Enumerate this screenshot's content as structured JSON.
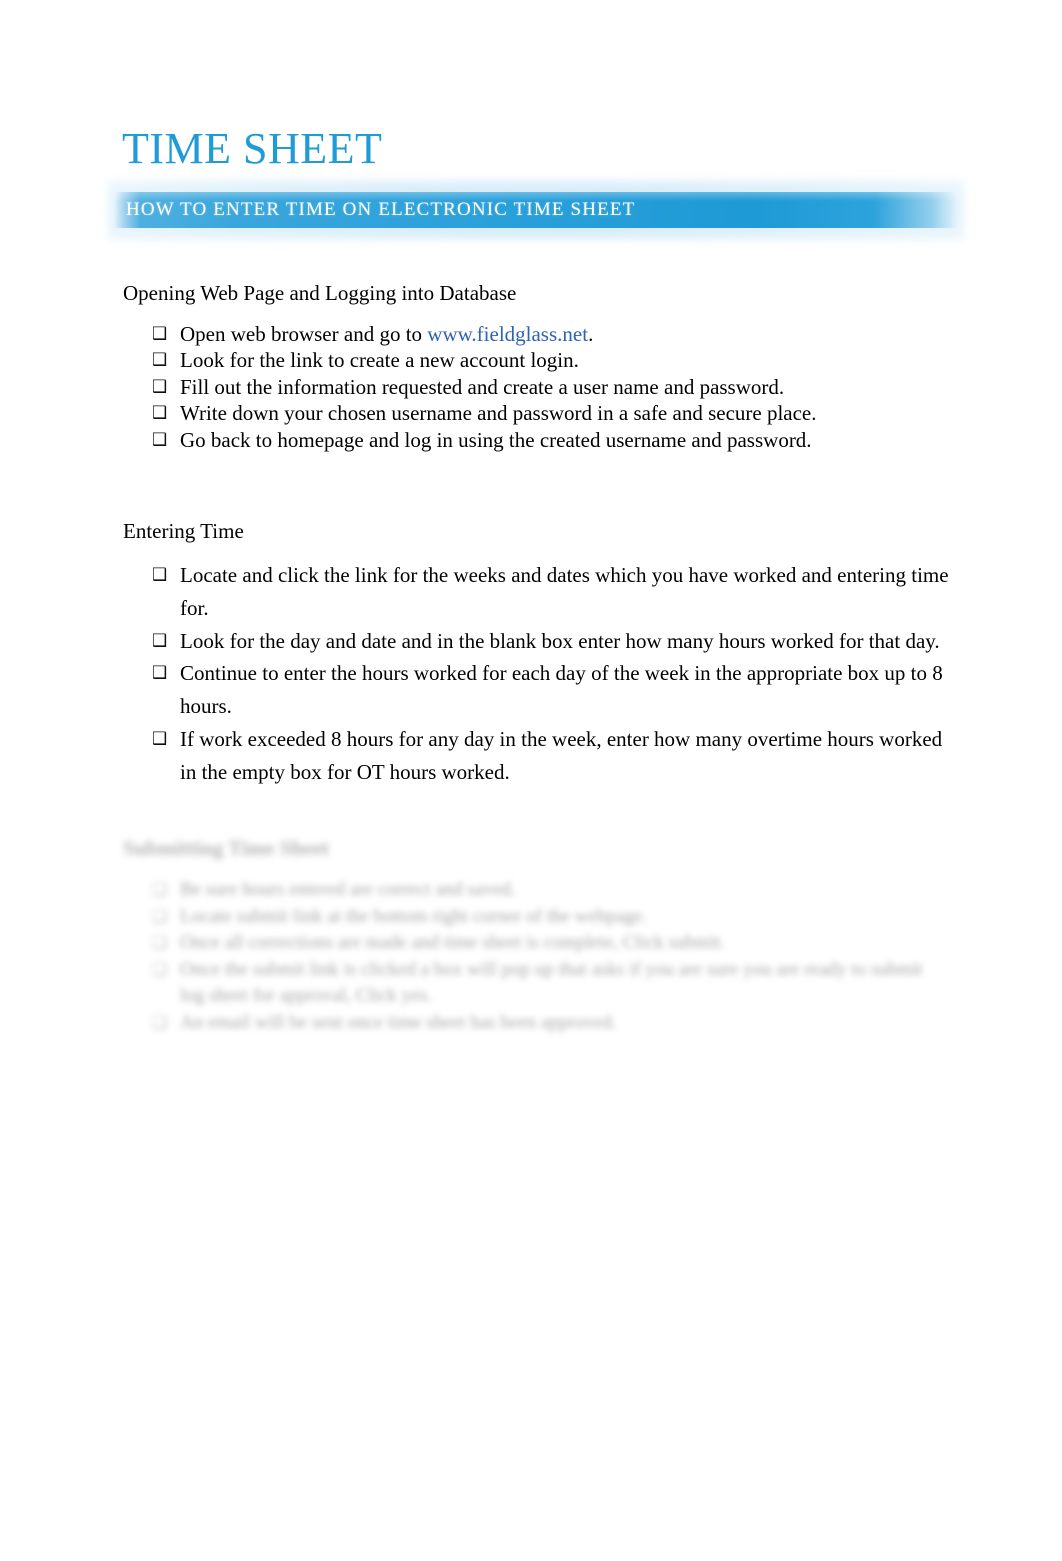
{
  "document": {
    "title": "TIME SHEET",
    "banner_subtitle": "HOW TO ENTER TIME ON ELECTRONIC TIME SHEET",
    "bullet_glyph": "❑",
    "colors": {
      "title_blue": "#1f9bd8",
      "banner_blue_left": "#4fb0e0",
      "banner_blue_right": "#1e9ad6",
      "link_blue": "#2d63b3",
      "body_text": "#000000",
      "page_background": "#ffffff"
    }
  },
  "sections": [
    {
      "heading": "Opening Web Page and Logging into Database",
      "items": [
        {
          "before": "Open web browser and go to ",
          "link": "www.fieldglass.net",
          "after": "."
        },
        {
          "text": "Look for the link to create a new account login."
        },
        {
          "text": "Fill out the information requested and create a user name and password."
        },
        {
          "text": "Write down your chosen username and password in a safe and secure place."
        },
        {
          "text": "Go back to homepage and log in using the created username and password."
        }
      ]
    },
    {
      "heading": "Entering Time",
      "items": [
        {
          "text": "Locate and click the link for the weeks and dates which you have worked and entering time for."
        },
        {
          "text": "Look for the day and date and in the blank box enter how many hours worked for that day."
        },
        {
          "text": "Continue to enter the hours worked for each day of the week in the appropriate box up to 8 hours."
        },
        {
          "text": "If work exceeded 8 hours for any day in the week, enter how many overtime hours worked in the empty box for OT hours worked."
        }
      ]
    },
    {
      "heading": "Submitting Time Sheet",
      "blurred": true,
      "items": [
        {
          "text": "Be sure hours entered are correct and saved."
        },
        {
          "text": "Locate submit link at the bottom right corner of the webpage."
        },
        {
          "text": "Once all corrections are made and time sheet is complete, Click submit."
        },
        {
          "text": "Once the submit link is clicked a box will pop up that asks if you are sure you are ready to submit log sheet for approval, Click yes."
        },
        {
          "text": "An email will be sent once time sheet has been approved."
        }
      ]
    }
  ]
}
